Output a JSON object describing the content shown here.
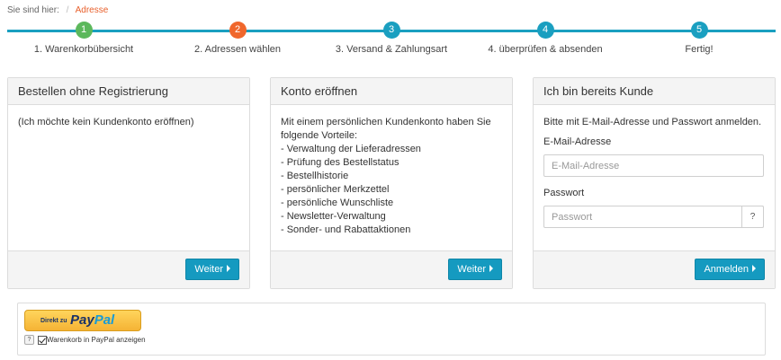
{
  "breadcrumb": {
    "prefix": "Sie sind hier:",
    "separator": "/",
    "current": "Adresse"
  },
  "steps": [
    {
      "number": "1",
      "label": "1. Warenkorbübersicht",
      "state": "done"
    },
    {
      "number": "2",
      "label": "2. Adressen wählen",
      "state": "active"
    },
    {
      "number": "3",
      "label": "3. Versand & Zahlungsart",
      "state": "todo"
    },
    {
      "number": "4",
      "label": "4. überprüfen & absenden",
      "state": "todo"
    },
    {
      "number": "5",
      "label": "Fertig!",
      "state": "todo"
    }
  ],
  "guest": {
    "title": "Bestellen ohne Registrierung",
    "text": "(Ich möchte kein Kundenkonto eröffnen)",
    "button": "Weiter"
  },
  "register": {
    "title": "Konto eröffnen",
    "intro": "Mit einem persönlichen Kundenkonto haben Sie folgende Vorteile:",
    "benefits": [
      "- Verwaltung der Lieferadressen",
      "- Prüfung des Bestellstatus",
      "- Bestellhistorie",
      "- persönlicher Merkzettel",
      "- persönliche Wunschliste",
      "- Newsletter-Verwaltung",
      "- Sonder- und Rabattaktionen"
    ],
    "button": "Weiter"
  },
  "login": {
    "title": "Ich bin bereits Kunde",
    "intro": "Bitte mit E-Mail-Adresse und Passwort anmelden.",
    "email_label": "E-Mail-Adresse",
    "email_placeholder": "E-Mail-Adresse",
    "email_value": "",
    "password_label": "Passwort",
    "password_placeholder": "Passwort",
    "password_value": "",
    "help_label": "?",
    "button": "Anmelden"
  },
  "paypal": {
    "button_prefix": "Direkt zu",
    "brand_pay": "Pay",
    "brand_pal": "Pal",
    "help_label": "?",
    "checkbox_label": "Warenkorb in PayPal anzeigen",
    "checkbox_checked": true
  },
  "colors": {
    "accent": "#159ac0",
    "step_done": "#5cb85c",
    "step_active": "#f0672c",
    "breadcrumb_current": "#e8602c"
  }
}
